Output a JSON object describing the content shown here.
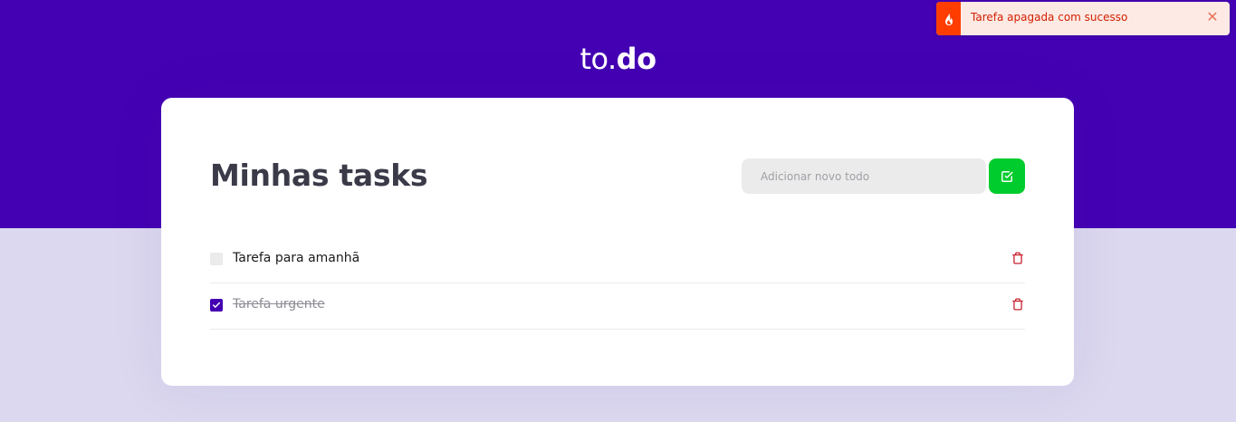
{
  "brand": {
    "prefix": "to.",
    "suffix": "do"
  },
  "card": {
    "title": "Minhas tasks",
    "new_todo_placeholder": "Adicionar novo todo",
    "new_todo_value": ""
  },
  "tasks": [
    {
      "title": "Tarefa para amanhã",
      "done": false
    },
    {
      "title": "Tarefa urgente",
      "done": true
    }
  ],
  "toast": {
    "message": "Tarefa apagada com sucesso",
    "close": "✕"
  },
  "icons": {
    "toast": "fire-icon",
    "add": "check-square-icon",
    "delete": "trash-icon",
    "checked": "check-icon"
  },
  "colors": {
    "hero": "#4400b3",
    "background": "#dcd8ef",
    "add_button": "#00cc2d",
    "delete_icon": "#c8202e",
    "toast_bg": "#fdeae4",
    "toast_accent": "#ff3d00",
    "toast_text": "#d11f00"
  }
}
